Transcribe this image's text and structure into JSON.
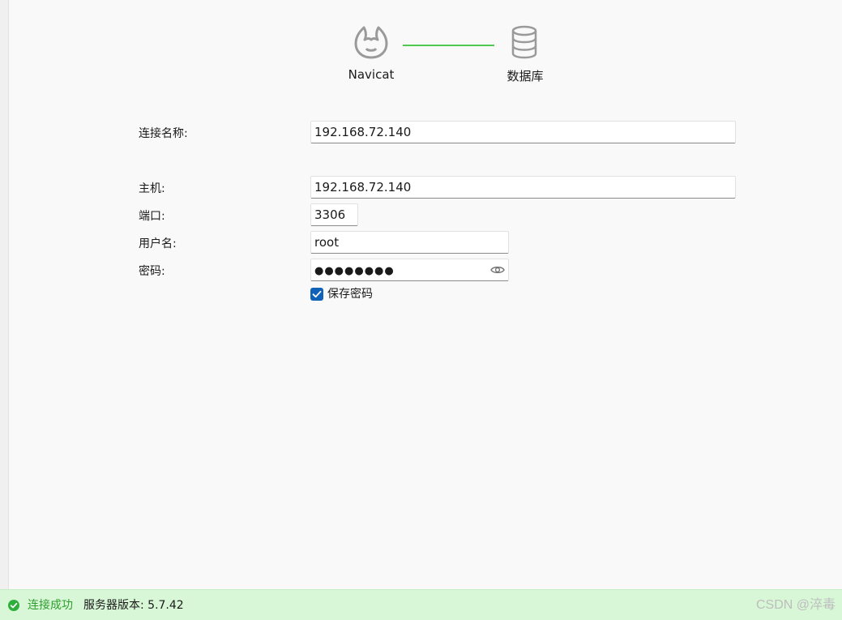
{
  "diagram": {
    "source_label": "Navicat",
    "target_label": "数据库",
    "link_color": "#4ec94e",
    "source_icon": "navicat-logo-icon",
    "target_icon": "database-icon"
  },
  "form": {
    "connection_name": {
      "label": "连接名称:",
      "value": "192.168.72.140"
    },
    "host": {
      "label": "主机:",
      "value": "192.168.72.140"
    },
    "port": {
      "label": "端口:",
      "value": "3306"
    },
    "username": {
      "label": "用户名:",
      "value": "root"
    },
    "password": {
      "label": "密码:",
      "value": "●●●●●●●●",
      "toggle_icon": "eye-icon"
    },
    "save_password": {
      "label": "保存密码",
      "checked": true
    }
  },
  "status": {
    "text": "连接成功",
    "version": "服务器版本: 5.7.42",
    "icon": "check-circle-icon",
    "color": "#2e9e2e",
    "background": "#d7f7d7"
  },
  "watermark": "CSDN @淬毒",
  "colors": {
    "accent": "#0f62b8",
    "background": "#f9f9f9"
  }
}
